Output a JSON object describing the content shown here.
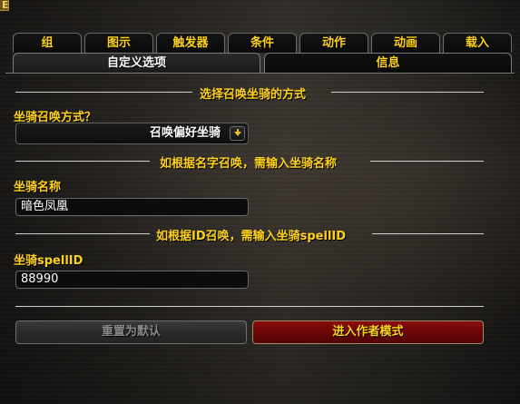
{
  "window": {
    "corner_glyph": "E"
  },
  "tabs": [
    {
      "label": "组"
    },
    {
      "label": "图示"
    },
    {
      "label": "触发器"
    },
    {
      "label": "条件"
    },
    {
      "label": "动作"
    },
    {
      "label": "动画"
    },
    {
      "label": "载入"
    }
  ],
  "subtabs": {
    "custom_options": "自定义选项",
    "info": "信息"
  },
  "sections": {
    "method_title": "选择召唤坐骑的方式",
    "by_name_title": "如根据名字召唤，需输入坐骑名称",
    "by_id_title": "如根据ID召唤，需输入坐骑spellID"
  },
  "fields": {
    "method_label": "坐骑召唤方式？",
    "method_value": "召唤偏好坐骑",
    "name_label": "坐骑名称",
    "name_value": "暗色凤凰",
    "spellid_label": "坐骑spellID",
    "spellid_value": "88990"
  },
  "buttons": {
    "reset": "重置为默认",
    "author_mode": "进入作者模式"
  },
  "colors": {
    "gold_text": "#ffd21a",
    "author_button": "#6a0606",
    "disabled_text": "#8a8a8a"
  },
  "icons": {
    "dropdown": "chevron-down-icon"
  }
}
